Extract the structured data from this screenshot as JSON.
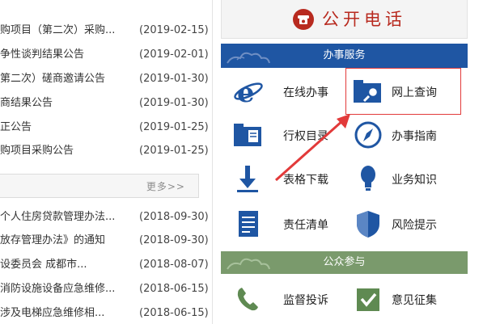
{
  "news_top": [
    {
      "title": "购项目（第二次）采购...",
      "date": "(2019-02-15)"
    },
    {
      "title": "争性谈判结果公告",
      "date": "(2019-02-01)"
    },
    {
      "title": "第二次）磋商邀请公告",
      "date": "(2019-01-30)"
    },
    {
      "title": "商结果公告",
      "date": "(2019-01-30)"
    },
    {
      "title": "正公告",
      "date": "(2019-01-25)"
    },
    {
      "title": "购项目采购公告",
      "date": "(2019-01-25)"
    }
  ],
  "more_label": "更多>>",
  "news_bottom": [
    {
      "title": "个人住房贷款管理办法...",
      "date": "(2018-09-30)"
    },
    {
      "title": "放存管理办法》的通知",
      "date": "(2018-09-30)"
    },
    {
      "title": "设委员会 成都市...",
      "date": "(2018-08-07)"
    },
    {
      "title": "消防设施设备应急维修...",
      "date": "(2018-06-15)"
    },
    {
      "title": "涉及电梯应急维修相...",
      "date": "(2018-06-15)"
    }
  ],
  "phone_title": "公开电话",
  "section_service": "办事服务",
  "section_public": "公众参与",
  "services": [
    {
      "label": "在线办事",
      "icon": "ie-browser-icon"
    },
    {
      "label": "网上查询",
      "icon": "folder-search-icon"
    },
    {
      "label": "行权目录",
      "icon": "catalog-folder-icon"
    },
    {
      "label": "办事指南",
      "icon": "compass-icon"
    },
    {
      "label": "表格下载",
      "icon": "download-icon"
    },
    {
      "label": "业务知识",
      "icon": "lightbulb-icon"
    },
    {
      "label": "责任清单",
      "icon": "document-list-icon"
    },
    {
      "label": "风险提示",
      "icon": "shield-icon"
    }
  ],
  "public": [
    {
      "label": "监督投诉",
      "icon": "telephone-icon"
    },
    {
      "label": "意见征集",
      "icon": "check-mail-icon"
    }
  ],
  "colors": {
    "blue": "#1f56a3",
    "red": "#b82a1f",
    "green": "#7a9a6c",
    "highlight": "#e23a3a"
  }
}
